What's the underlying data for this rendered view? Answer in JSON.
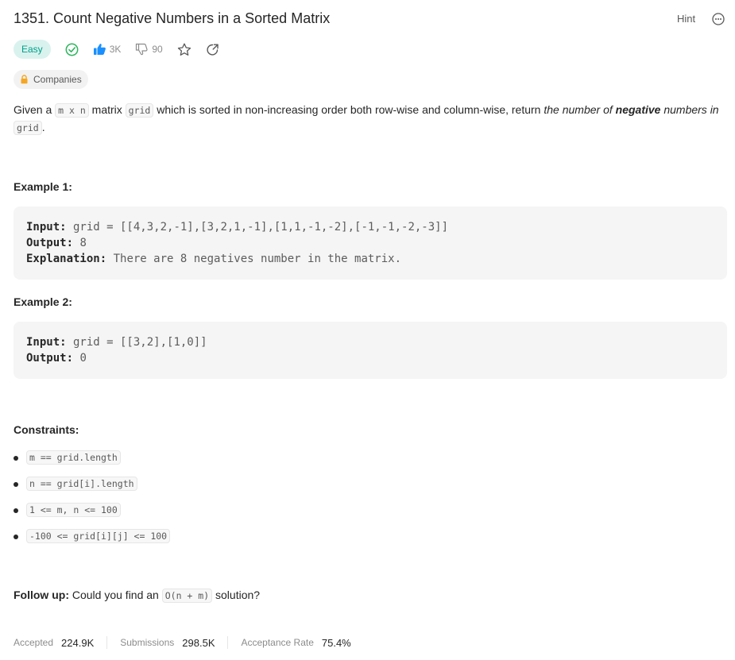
{
  "problem": {
    "title": "1351. Count Negative Numbers in a Sorted Matrix",
    "hint_label": "Hint",
    "difficulty": "Easy",
    "likes": "3K",
    "dislikes": "90",
    "companies_label": "Companies"
  },
  "description": {
    "p1": "Given a ",
    "code_mxn": "m x n",
    "p2": " matrix ",
    "code_grid": "grid",
    "p3": " which is sorted in non-increasing order both row-wise and column-wise, return ",
    "em1": "the number of ",
    "strong": "negative",
    "em2": " numbers in ",
    "code_grid2": "grid",
    "p4": "."
  },
  "examples": [
    {
      "heading": "Example 1:",
      "input_label": "Input:",
      "input": " grid = [[4,3,2,-1],[3,2,1,-1],[1,1,-1,-2],[-1,-1,-2,-3]]",
      "output_label": "Output:",
      "output": " 8",
      "explanation_label": "Explanation:",
      "explanation": " There are 8 negatives number in the matrix."
    },
    {
      "heading": "Example 2:",
      "input_label": "Input:",
      "input": " grid = [[3,2],[1,0]]",
      "output_label": "Output:",
      "output": " 0"
    }
  ],
  "constraints": {
    "heading": "Constraints:",
    "items": [
      "m == grid.length",
      "n == grid[i].length",
      "1 <= m, n <= 100",
      "-100 <= grid[i][j] <= 100"
    ]
  },
  "follow_up": {
    "label": "Follow up:",
    "text1": " Could you find an ",
    "code": "O(n + m)",
    "text2": " solution?"
  },
  "stats": {
    "accepted_label": "Accepted",
    "accepted": "224.9K",
    "submissions_label": "Submissions",
    "submissions": "298.5K",
    "rate_label": "Acceptance Rate",
    "rate": "75.4%"
  },
  "colors": {
    "easy_bg": "#d9f2ee",
    "easy_text": "#00a08a",
    "solved_green": "#2db55d",
    "like_blue": "#1a90ff",
    "lock_orange": "#f5a623"
  }
}
